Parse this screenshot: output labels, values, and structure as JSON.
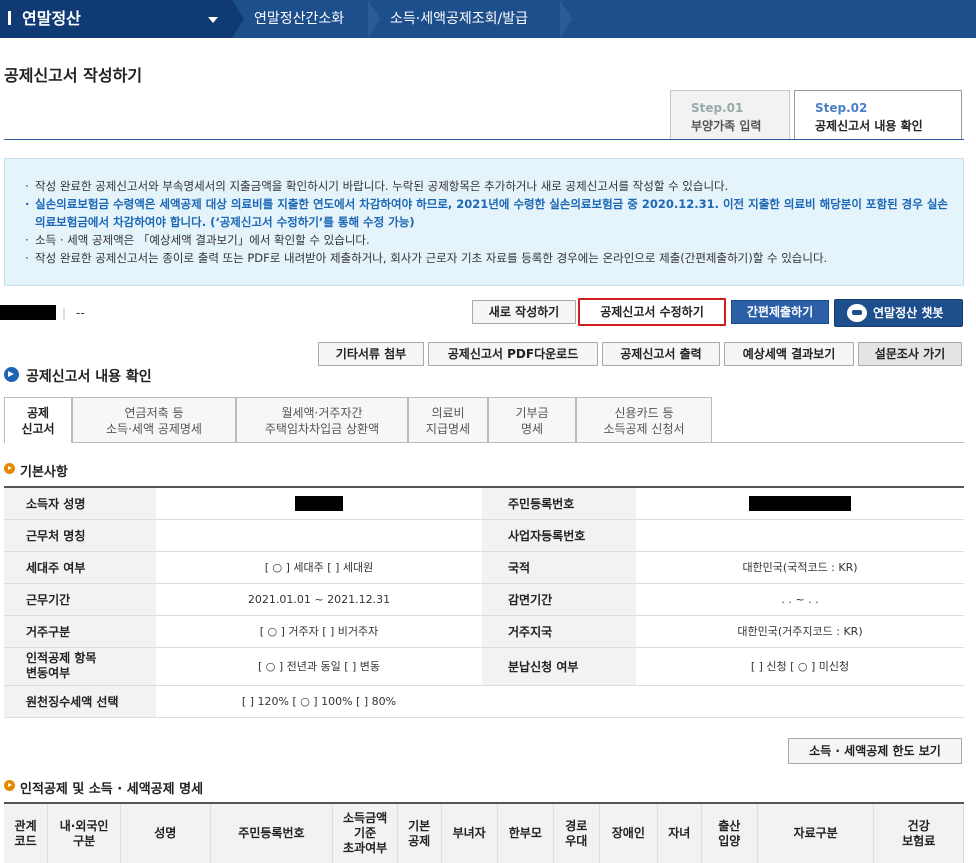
{
  "nav": {
    "menu_title": "연말정산",
    "crumb1": "연말정산간소화",
    "crumb2": "소득·세액공제조회/발급"
  },
  "page": {
    "title": "공제신고서 작성하기"
  },
  "steps": [
    {
      "num": "Step.01",
      "label": "부양가족 입력"
    },
    {
      "num": "Step.02",
      "label": "공제신고서 내용 확인"
    }
  ],
  "notice": [
    "작성 완료한 공제신고서와 부속명세서의 지출금액을 확인하시기 바랍니다. 누락된 공제항목은 추가하거나 새로 공제신고서를 작성할 수 있습니다.",
    "실손의료보험금 수령액은 세액공제 대상 의료비를 지출한 연도에서 차감하여야 하므로, 2021년에 수령한 실손의료보험금 중 2020.12.31. 이전 지출한 의료비 해당분이 포함된 경우 실손의료보험금에서 차감하여야 합니다. (‘공제신고서 수정하기’를 통해 수정 가능)",
    "소득 · 세액 공제액은 「예상세액 결과보기」에서 확인할 수 있습니다.",
    "작성 완료한 공제신고서는 종이로 출력 또는 PDF로 내려받아 제출하거나, 회사가 근로자 기초 자료를 등록한 경우에는 온라인으로 제출(간편제출하기)할 수 있습니다."
  ],
  "user_line": {
    "separator": "|",
    "value": "--"
  },
  "actions": {
    "new": "새로 작성하기",
    "edit": "공제신고서 수정하기",
    "simple_submit": "간편제출하기",
    "chatbot": "연말정산 챗봇",
    "attach": "기타서류 첨부",
    "pdf": "공제신고서 PDF다운로드",
    "print": "공제신고서 출력",
    "estimate": "예상세액 결과보기",
    "survey": "설문조사 가기"
  },
  "section": {
    "title": "공제신고서 내용 확인"
  },
  "tabs": [
    {
      "l1": "공제",
      "l2": "신고서"
    },
    {
      "l1": "연금저축 등",
      "l2": "소득·세액 공제명세"
    },
    {
      "l1": "월세액·거주자간",
      "l2": "주택임차차입금 상환액"
    },
    {
      "l1": "의료비",
      "l2": "지급명세"
    },
    {
      "l1": "기부금",
      "l2": "명세"
    },
    {
      "l1": "신용카드 등",
      "l2": "소득공제 신청서"
    }
  ],
  "basic": {
    "title": "기본사항",
    "rows": [
      {
        "l1": "소득자 성명",
        "v1": "",
        "l2": "주민등록번호",
        "v2": ""
      },
      {
        "l1": "근무처 명칭",
        "v1": "",
        "l2": "사업자등록번호",
        "v2": ""
      },
      {
        "l1": "세대주 여부",
        "v1": "[ ○ ] 세대주  [    ] 세대원",
        "l2": "국적",
        "v2": "대한민국(국적코드 : KR)"
      },
      {
        "l1": "근무기간",
        "v1": "2021.01.01 ~ 2021.12.31",
        "l2": "감면기간",
        "v2": ". . ~ . ."
      },
      {
        "l1": "거주구분",
        "v1": "[ ○ ] 거주자  [    ] 비거주자",
        "l2": "거주지국",
        "v2": "대한민국(거주지코드 : KR)"
      },
      {
        "l1": "인적공제 항목",
        "l1b": "변동여부",
        "v1": "[ ○ ] 전년과 동일  [    ] 변동",
        "l2": "분납신청 여부",
        "v2": "[    ] 신청 [ ○ ] 미신청"
      },
      {
        "l1": "원천징수세액 선택",
        "v1": "[    ] 120%  [ ○ ] 100% [    ] 80%",
        "l2": "",
        "v2": ""
      }
    ]
  },
  "limit_button": "소득 · 세액공제 한도 보기",
  "detail": {
    "title": "인적공제 및 소득 · 세액공제 명세",
    "columns": [
      {
        "l1": "관계",
        "l2": "코드"
      },
      {
        "l1": "내·외국인",
        "l2": "구분"
      },
      {
        "l1": "성명",
        "l2": ""
      },
      {
        "l1": "주민등록번호",
        "l2": ""
      },
      {
        "l1": "소득금액",
        "l2": "기준",
        "l3": "초과여부"
      },
      {
        "l1": "기본",
        "l2": "공제"
      },
      {
        "l1": "부녀자",
        "l2": ""
      },
      {
        "l1": "한부모",
        "l2": ""
      },
      {
        "l1": "경로",
        "l2": "우대"
      },
      {
        "l1": "장애인",
        "l2": ""
      },
      {
        "l1": "자녀",
        "l2": ""
      },
      {
        "l1": "출산",
        "l2": "입양"
      },
      {
        "l1": "자료구분",
        "l2": ""
      },
      {
        "l1": "건강",
        "l2": "보험료"
      }
    ]
  }
}
